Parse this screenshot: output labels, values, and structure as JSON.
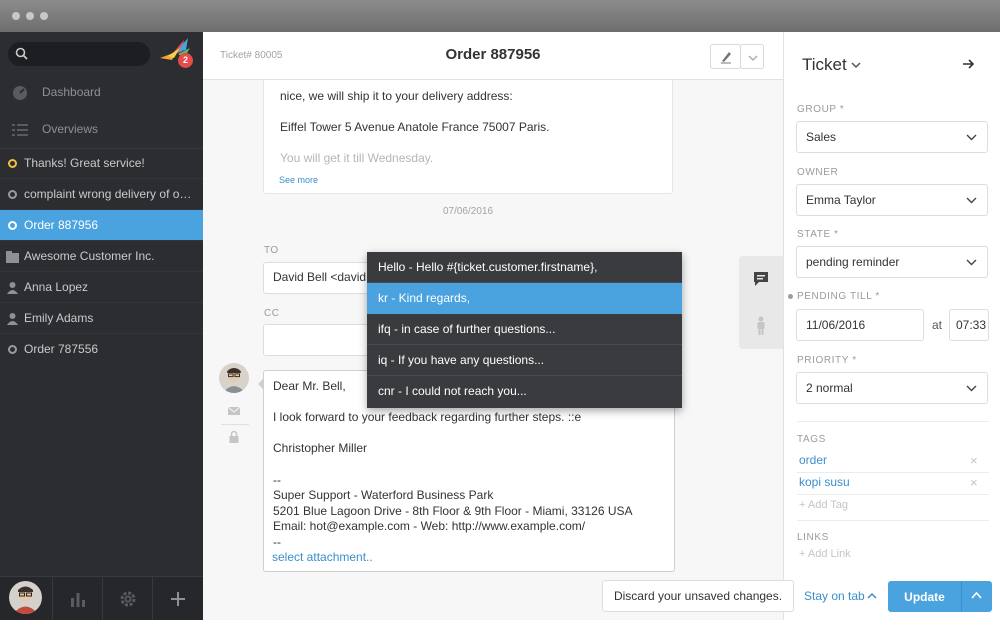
{
  "sidebar": {
    "notification_count": "2",
    "nav": [
      {
        "label": "Dashboard"
      },
      {
        "label": "Overviews"
      }
    ],
    "tasks": [
      {
        "label": "Thanks! Great service!",
        "indicator": "yellow"
      },
      {
        "label": "complaint wrong delivery of order",
        "indicator": "gray"
      },
      {
        "label": "Order 887956",
        "indicator": "active"
      },
      {
        "label": "Awesome Customer Inc.",
        "icon": "organization-icon"
      },
      {
        "label": "Anna Lopez",
        "icon": "user-icon"
      },
      {
        "label": "Emily Adams",
        "icon": "user-icon"
      },
      {
        "label": "Order 787556",
        "indicator": "gray"
      }
    ]
  },
  "main": {
    "ticket_number": "Ticket# 80005",
    "title": "Order 887956",
    "article": {
      "line1": "nice, we will ship it to your delivery address:",
      "line2": "Eiffel Tower 5 Avenue Anatole France 75007 Paris.",
      "line3": "You will get it till Wednesday.",
      "see_more": "See more"
    },
    "date": "07/06/2016",
    "reply": {
      "to_label": "TO",
      "to_value": "David Bell <david@",
      "cc_label": "CC",
      "body": {
        "greeting": "Dear Mr. Bell,",
        "text": "I look forward to your feedback regarding further steps. ::e",
        "name": "Christopher Miller",
        "sig_dash": "--",
        "sig_company": "Super Support - Waterford Business Park",
        "sig_address": "5201 Blue Lagoon Drive - 8th Floor & 9th Floor - Miami, 33126 USA",
        "sig_contact": "Email: hot@example.com - Web: http://www.example.com/",
        "sig_dash2": "--"
      },
      "attachment_link": "select attachment.."
    }
  },
  "text_modules": [
    {
      "label": "Hello - Hello #{ticket.customer.firstname},",
      "active": false
    },
    {
      "label": "kr - Kind regards,",
      "active": true
    },
    {
      "label": "ifq - in case of further questions...",
      "active": false
    },
    {
      "label": "iq - If you have any questions...",
      "active": false
    },
    {
      "label": "cnr - I could not reach you...",
      "active": false
    }
  ],
  "ticket_panel": {
    "title": "Ticket",
    "group_label": "GROUP *",
    "group_value": "Sales",
    "owner_label": "OWNER",
    "owner_value": "Emma Taylor",
    "state_label": "STATE *",
    "state_value": "pending reminder",
    "pending_label": "PENDING TILL *",
    "pending_date": "11/06/2016",
    "pending_at": "at",
    "pending_time": "07:33",
    "priority_label": "PRIORITY *",
    "priority_value": "2 normal",
    "tags_label": "TAGS",
    "tags": [
      "order",
      "kopi susu"
    ],
    "add_tag": "+ Add Tag",
    "links_label": "LINKS",
    "add_link": "+ Add Link"
  },
  "bottom": {
    "discard_label": "Discard your unsaved changes.",
    "stay_label": "Stay on tab",
    "update_label": "Update"
  },
  "colors": {
    "accent": "#4aa3df",
    "sidebar_bg": "#2c2d30",
    "badge": "#e54b4b"
  }
}
